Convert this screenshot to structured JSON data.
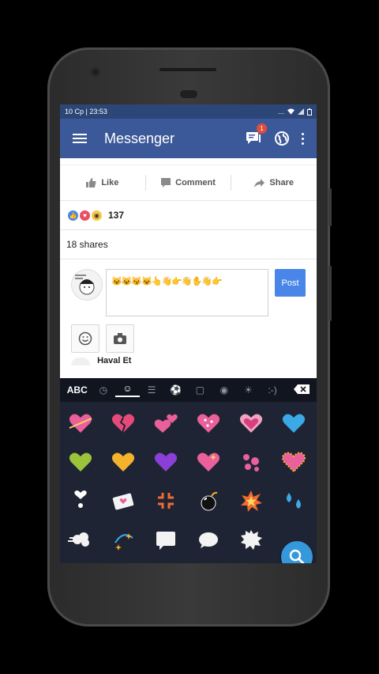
{
  "statusbar": {
    "time": "10 Cp | 23:53",
    "indicators": "..."
  },
  "toolbar": {
    "title": "Messenger",
    "badge_count": "1"
  },
  "post_actions": {
    "like": "Like",
    "comment": "Comment",
    "share": "Share"
  },
  "reactions": {
    "count": "137"
  },
  "shares": {
    "text": "18 shares"
  },
  "composer": {
    "text": "😺😺😼😺👆👋👉👋✋👋👉",
    "post_label": "Post"
  },
  "next_post": {
    "name": "Haval Et"
  },
  "keyboard": {
    "abc_label": "ABC",
    "tabs": [
      "recent-icon",
      "smiley-icon",
      "food-icon",
      "ball-icon",
      "car-icon",
      "animal-icon",
      "bulb-icon",
      "emoticon-icon"
    ],
    "emoticon_label": ":-)"
  },
  "emoji_grid": [
    "💘",
    "💔",
    "💕",
    "💟",
    "💗",
    "💙",
    "💚",
    "💛",
    "💜",
    "💖",
    "💞",
    "💓",
    "❣",
    "💌",
    "💢",
    "💣",
    "💥",
    "💦",
    "💨",
    "💫",
    "💬",
    "🗨",
    "🗯",
    "🔍"
  ],
  "colors": {
    "brand": "#3b5998",
    "statusbar": "#2d4678",
    "post_button": "#4a86e8",
    "keyboard_bg": "#1f2434",
    "fab": "#3498db"
  }
}
